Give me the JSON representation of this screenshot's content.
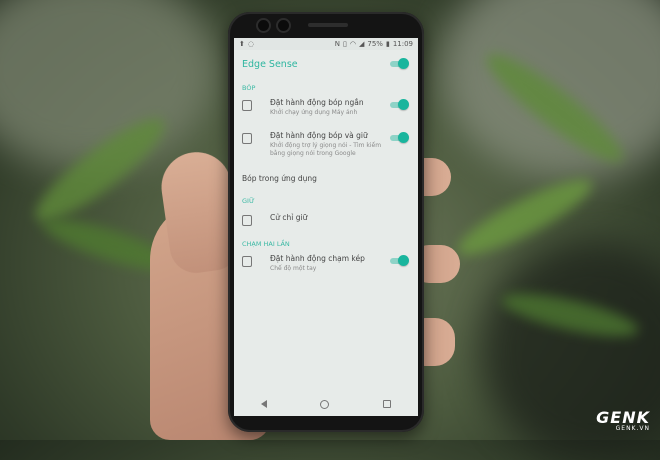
{
  "status_bar": {
    "battery": "75%",
    "time": "11:09"
  },
  "app_bar": {
    "title": "Edge Sense",
    "master_toggle_on": true
  },
  "sections": {
    "squeeze": {
      "header": "BÓP",
      "items": [
        {
          "title": "Đặt hành động bóp ngắn",
          "subtitle": "Khởi chạy ứng dụng Máy ảnh",
          "toggle_on": true
        },
        {
          "title": "Đặt hành động bóp và giữ",
          "subtitle": "Khởi động trợ lý giọng nói - Tìm kiếm bằng giọng nói trong Google",
          "toggle_on": true
        }
      ],
      "extra_item": "Bóp trong ứng dụng"
    },
    "hold": {
      "header": "GIỮ",
      "item": "Cử chỉ giữ"
    },
    "double_tap": {
      "header": "CHẠM HAI LẦN",
      "item": {
        "title": "Đặt hành động chạm kép",
        "subtitle": "Chế độ một tay",
        "toggle_on": true
      }
    }
  },
  "watermark": {
    "brand": "GENK",
    "domain": "GENK.VN"
  },
  "colors": {
    "accent": "#19b59d",
    "screen_bg": "#e7ebe9"
  }
}
